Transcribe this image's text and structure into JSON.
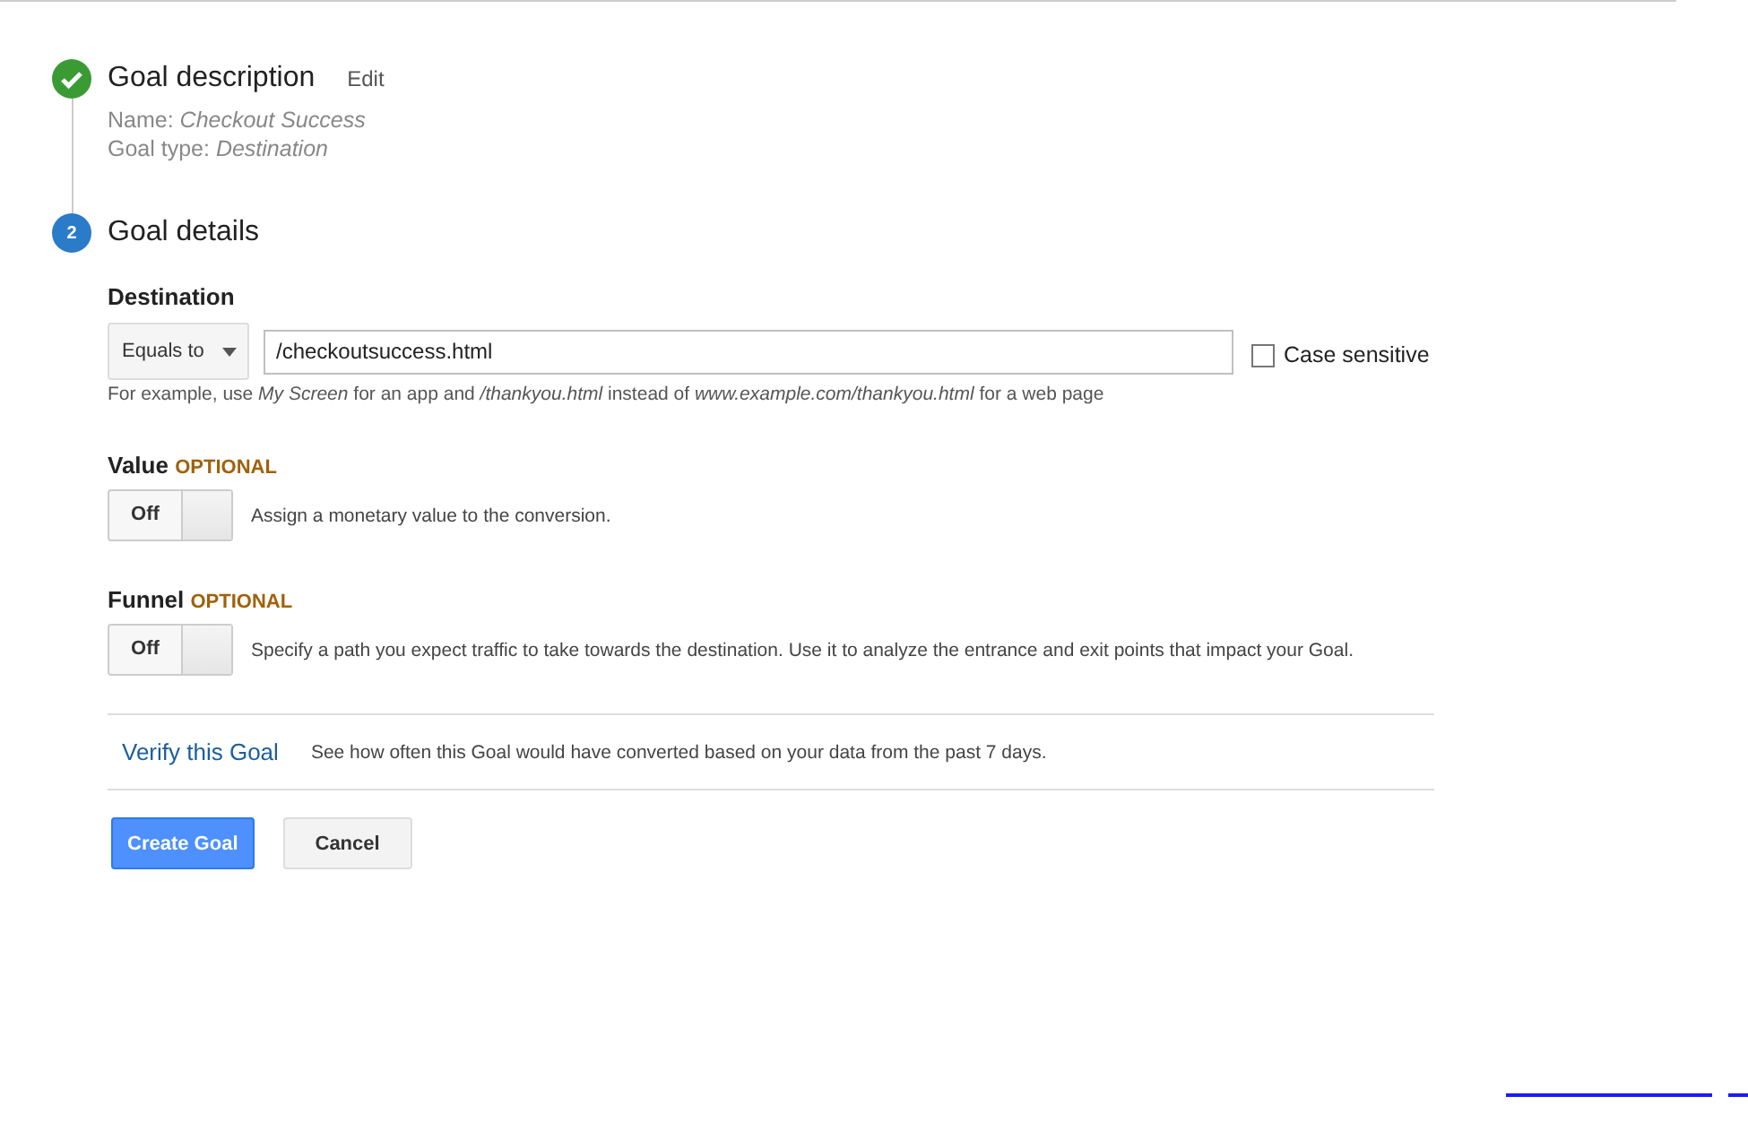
{
  "steps": [
    {
      "kind": "done",
      "title": "Goal description",
      "edit_link": "Edit",
      "details": [
        {
          "label": "Name:",
          "value": "Checkout Success"
        },
        {
          "label": "Goal type:",
          "value": "Destination"
        }
      ]
    },
    {
      "kind": "number",
      "number": "2",
      "title": "Goal details"
    }
  ],
  "destination": {
    "heading": "Destination",
    "match": "Equals to",
    "value": "/checkoutsuccess.html",
    "case_sensitive": {
      "label": "Case sensitive",
      "checked": false
    },
    "hint": "For example, use *My Screen* for an app and */thankyou.html* instead of *www.example.com/thankyou.html* for a web page"
  },
  "options": [
    {
      "heading": "Value",
      "tag": "OPTIONAL",
      "toggle": {
        "label": "Off",
        "on": false
      },
      "description": "Assign a monetary value to the conversion."
    },
    {
      "heading": "Funnel",
      "tag": "OPTIONAL",
      "toggle": {
        "label": "Off",
        "on": false
      },
      "description": "Specify a path you expect traffic to take towards the destination. Use it to analyze the entrance and exit points that impact your Goal."
    }
  ],
  "verify": {
    "link": "Verify this Goal",
    "description": "See how often this Goal would have converted based on your data from the past 7 days."
  },
  "buttons": [
    {
      "kind": "primary",
      "label": "Create Goal"
    },
    {
      "kind": "secondary",
      "label": "Cancel"
    }
  ]
}
